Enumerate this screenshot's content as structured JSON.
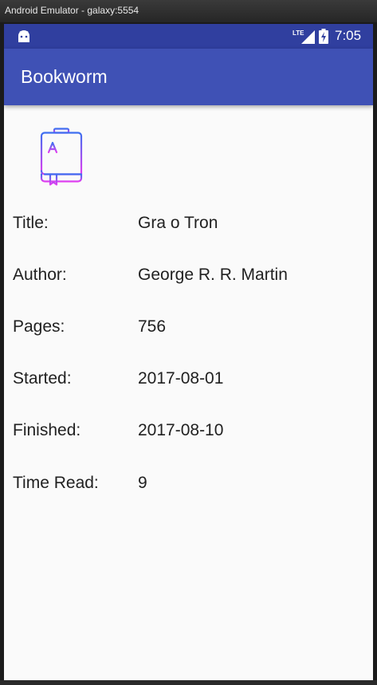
{
  "window": {
    "title": "Android Emulator - galaxy:5554"
  },
  "status_bar": {
    "time": "7:05",
    "network_label": "LTE",
    "icons": [
      "android-icon",
      "lte-signal-icon",
      "battery-charging-icon"
    ]
  },
  "app_bar": {
    "title": "Bookworm"
  },
  "book": {
    "icon": "book-icon",
    "fields": [
      {
        "label": "Title:",
        "value": "Gra o Tron"
      },
      {
        "label": "Author:",
        "value": "George R. R. Martin"
      },
      {
        "label": "Pages:",
        "value": "756"
      },
      {
        "label": "Started:",
        "value": "2017-08-01"
      },
      {
        "label": "Finished:",
        "value": "2017-08-10"
      },
      {
        "label": "Time Read:",
        "value": "9"
      }
    ]
  },
  "colors": {
    "status_bar": "#303f9f",
    "app_bar": "#3f51b5",
    "icon_gradient_start": "#3d6ff0",
    "icon_gradient_end": "#e23df0"
  }
}
